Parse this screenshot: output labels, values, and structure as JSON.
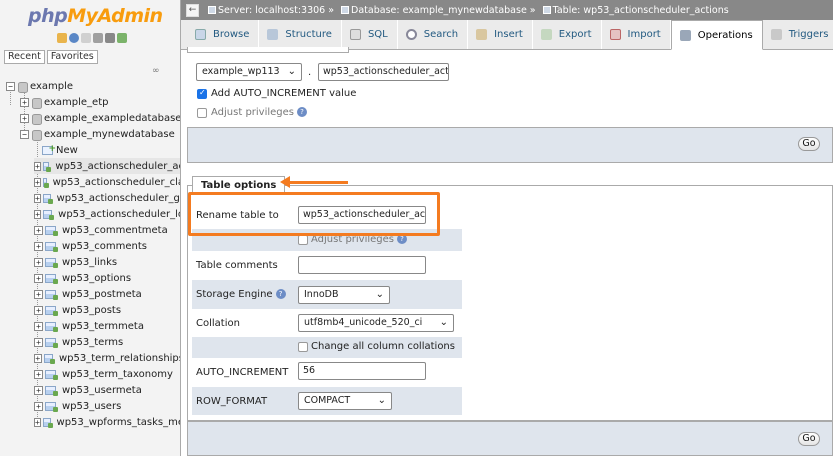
{
  "logo": {
    "php": "php",
    "myadmin": "MyAdmin"
  },
  "nav_tabs": {
    "recent": "Recent",
    "favorites": "Favorites"
  },
  "tree": {
    "root": "example",
    "databases": [
      "example_etp",
      "example_exampledatabase",
      "example_mynewdatabase"
    ],
    "new_label": "New",
    "tables": [
      "wp53_actionscheduler_ac",
      "wp53_actionscheduler_cla",
      "wp53_actionscheduler_gr",
      "wp53_actionscheduler_lo",
      "wp53_commentmeta",
      "wp53_comments",
      "wp53_links",
      "wp53_options",
      "wp53_postmeta",
      "wp53_posts",
      "wp53_termmeta",
      "wp53_terms",
      "wp53_term_relationships",
      "wp53_term_taxonomy",
      "wp53_usermeta",
      "wp53_users",
      "wp53_wpforms_tasks_me"
    ]
  },
  "breadcrumb": {
    "server": "Server: localhost:3306",
    "database": "Database: example_mynewdatabase",
    "table": "Table: wp53_actionscheduler_actions"
  },
  "tabs": [
    "Browse",
    "Structure",
    "SQL",
    "Search",
    "Insert",
    "Export",
    "Import",
    "Operations",
    "Triggers"
  ],
  "move_section": {
    "db_select": "example_wp113",
    "dot": ".",
    "table_name": "wp53_actionscheduler_actic",
    "add_auto_increment": "Add AUTO_INCREMENT value",
    "adjust_privileges": "Adjust privileges",
    "go": "Go"
  },
  "table_options": {
    "legend": "Table options",
    "rename_label": "Rename table to",
    "rename_value": "wp53_actionscheduler_actic",
    "adjust_privileges": "Adjust privileges",
    "comments_label": "Table comments",
    "comments_value": "",
    "engine_label": "Storage Engine",
    "engine_value": "InnoDB",
    "collation_label": "Collation",
    "collation_value": "utf8mb4_unicode_520_ci",
    "change_collations": "Change all column collations",
    "auto_increment_label": "AUTO_INCREMENT",
    "auto_increment_value": "56",
    "row_format_label": "ROW_FORMAT",
    "row_format_value": "COMPACT",
    "go": "Go"
  },
  "colors": {
    "highlight": "#f47b20",
    "php": "#6c78af",
    "myadmin": "#f89c0e",
    "breadcrumb_bg": "#888888",
    "row_alt": "#dfe5ed"
  }
}
